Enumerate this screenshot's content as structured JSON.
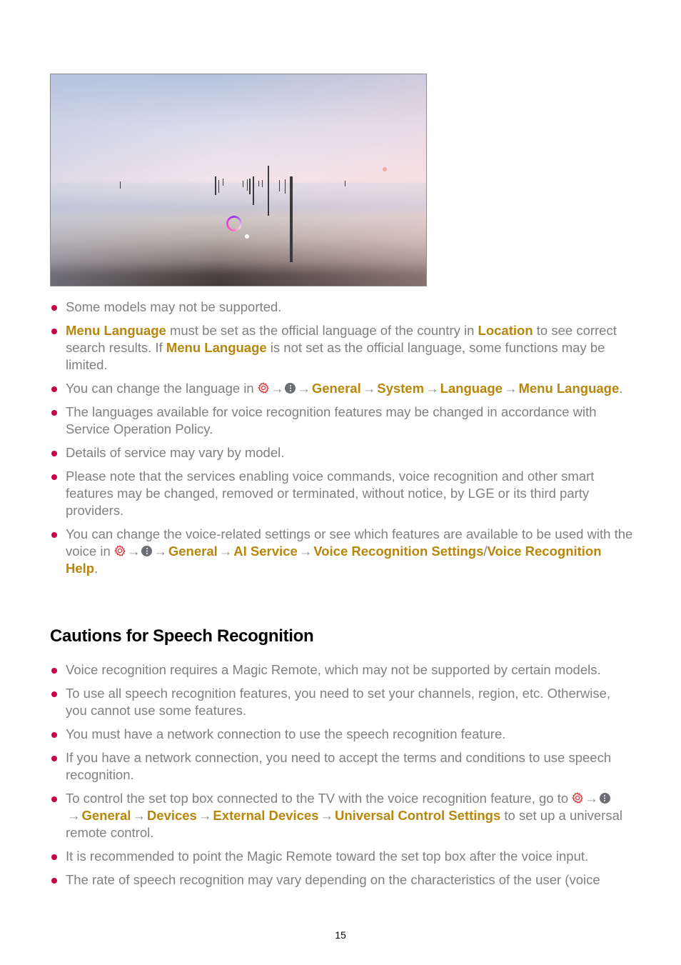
{
  "figure": {
    "alt": "TV screen showing a misty seascape with wooden posts and a voice recognition indicator",
    "icon": "voice-recognition-ring-icon",
    "colors": {
      "ring_start": "#8a2be2",
      "ring_end": "#ff5fc0"
    }
  },
  "colors": {
    "bullet": "#c8004a",
    "highlight": "#b8860b",
    "body_text": "#808080"
  },
  "notes": [
    {
      "parts": [
        {
          "t": "Some models may not be supported."
        }
      ]
    },
    {
      "parts": [
        {
          "t": "Menu Language",
          "hl": true
        },
        {
          "t": " must be set as the official language of the country in "
        },
        {
          "t": "Location",
          "hl": true
        },
        {
          "t": " to see correct search results. If "
        },
        {
          "t": "Menu Language",
          "hl": true
        },
        {
          "t": " is not set as the official language, some functions may be limited."
        }
      ]
    },
    {
      "parts": [
        {
          "t": "You can change the language in "
        },
        {
          "icon": "gear-icon"
        },
        {
          "icon": "arrow-right-icon"
        },
        {
          "icon": "more-dots-icon"
        },
        {
          "icon": "arrow-right-icon"
        },
        {
          "t": "General",
          "hl": true
        },
        {
          "icon": "arrow-right-icon"
        },
        {
          "t": "System",
          "hl": true
        },
        {
          "icon": "arrow-right-icon"
        },
        {
          "t": "Language",
          "hl": true
        },
        {
          "icon": "arrow-right-icon"
        },
        {
          "t": "Menu Language",
          "hl": true
        },
        {
          "t": "."
        }
      ]
    },
    {
      "parts": [
        {
          "t": "The languages available for voice recognition features may be changed in accordance with Service Operation Policy."
        }
      ]
    },
    {
      "parts": [
        {
          "t": "Details of service may vary by model."
        }
      ]
    },
    {
      "parts": [
        {
          "t": "Please note that the services enabling voice commands, voice recognition and other smart features may be changed, removed or terminated, without notice, by LGE or its third party providers."
        }
      ]
    },
    {
      "parts": [
        {
          "t": "You can change the voice-related settings or see which features are available to be used with the voice in "
        },
        {
          "icon": "gear-icon"
        },
        {
          "icon": "arrow-right-icon"
        },
        {
          "icon": "more-dots-icon"
        },
        {
          "icon": "arrow-right-icon"
        },
        {
          "t": "General",
          "hl": true
        },
        {
          "icon": "arrow-right-icon"
        },
        {
          "t": "AI Service",
          "hl": true
        },
        {
          "icon": "arrow-right-icon"
        },
        {
          "t": "Voice Recognition Settings",
          "hl": true
        },
        {
          "t": "/"
        },
        {
          "t": "Voice Recognition Help",
          "hl": true
        },
        {
          "t": "."
        }
      ]
    }
  ],
  "section": {
    "title": "Cautions for Speech Recognition"
  },
  "cautions": [
    {
      "parts": [
        {
          "t": "Voice recognition requires a Magic Remote, which may not be supported by certain models."
        }
      ]
    },
    {
      "parts": [
        {
          "t": "To use all speech recognition features, you need to set your channels, region, etc. Otherwise, you cannot use some features."
        }
      ]
    },
    {
      "parts": [
        {
          "t": "You must have a network connection to use the speech recognition feature."
        }
      ]
    },
    {
      "parts": [
        {
          "t": "If you have a network connection, you need to accept the terms and conditions to use speech recognition."
        }
      ]
    },
    {
      "parts": [
        {
          "t": "To control the set top box connected to the TV with the voice recognition feature, go to "
        },
        {
          "icon": "gear-icon"
        },
        {
          "icon": "arrow-right-icon"
        },
        {
          "icon": "more-dots-icon"
        },
        {
          "icon": "arrow-right-icon"
        },
        {
          "t": "General",
          "hl": true
        },
        {
          "icon": "arrow-right-icon"
        },
        {
          "t": "Devices",
          "hl": true
        },
        {
          "icon": "arrow-right-icon"
        },
        {
          "t": "External Devices",
          "hl": true
        },
        {
          "icon": "arrow-right-icon"
        },
        {
          "t": "Universal Control Settings",
          "hl": true
        },
        {
          "t": " to set up a universal remote control."
        }
      ]
    },
    {
      "parts": [
        {
          "t": "It is recommended to point the Magic Remote toward the set top box after the voice input."
        }
      ]
    },
    {
      "parts": [
        {
          "t": "The rate of speech recognition may vary depending on the characteristics of the user (voice"
        }
      ]
    }
  ],
  "page_number": "15"
}
